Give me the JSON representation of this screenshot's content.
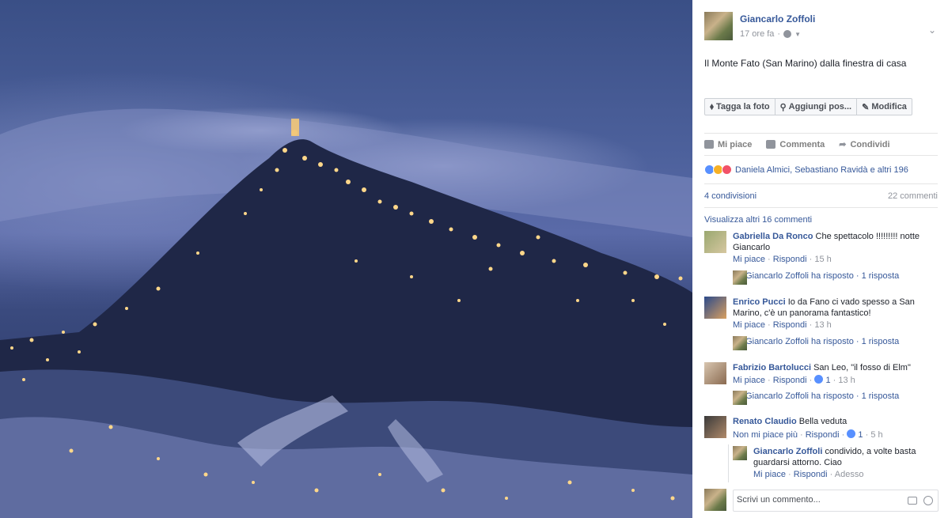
{
  "photo": {
    "alt": ""
  },
  "post": {
    "author": "Giancarlo Zoffoli",
    "time": "17 ore fa",
    "caption": "Il Monte Fato (San Marino) dalla finestra di casa",
    "actions": [
      "Tagga la foto",
      "Aggiungi pos...",
      "Modifica"
    ],
    "ufi": {
      "like": "Mi piace",
      "comment": "Commenta",
      "share": "Condividi"
    },
    "reactions_text": "Daniela Almici, Sebastiano Ravidà e altri 196",
    "shares": "4 condivisioni",
    "comments_count": "22 commenti",
    "more_comments": "Visualizza altri 16 commenti"
  },
  "comments": [
    {
      "name": "Gabriella Da Ronco",
      "text": "Che spettacolo !!!!!!!!! notte Giancarlo",
      "like": "Mi piace",
      "reply": "Rispondi",
      "time": "15 h",
      "replies": "Giancarlo Zoffoli ha risposto · 1 risposta"
    },
    {
      "name": "Enrico Pucci",
      "text": "Io da Fano ci vado spesso a San Marino, c'è un panorama fantastico!",
      "like": "Mi piace",
      "reply": "Rispondi",
      "time": "13 h",
      "replies": "Giancarlo Zoffoli ha risposto · 1 risposta"
    },
    {
      "name": "Fabrizio Bartolucci",
      "text": "San Leo, \"il fosso di Elm\"",
      "like": "Mi piace",
      "reply": "Rispondi",
      "likes": "1",
      "time": "13 h",
      "replies": "Giancarlo Zoffoli ha risposto · 1 risposta"
    },
    {
      "name": "Renato Claudio",
      "text": "Bella veduta",
      "like": "Non mi piace più",
      "reply": "Rispondi",
      "likes": "1",
      "time": "5 h"
    }
  ],
  "nested_reply": {
    "name": "Giancarlo Zoffoli",
    "text": "condivido, a volte basta guardarsi attorno. Ciao",
    "like": "Mi piace",
    "reply": "Rispondi",
    "time": "Adesso"
  },
  "writer": {
    "placeholder": "Scrivi un commento..."
  }
}
